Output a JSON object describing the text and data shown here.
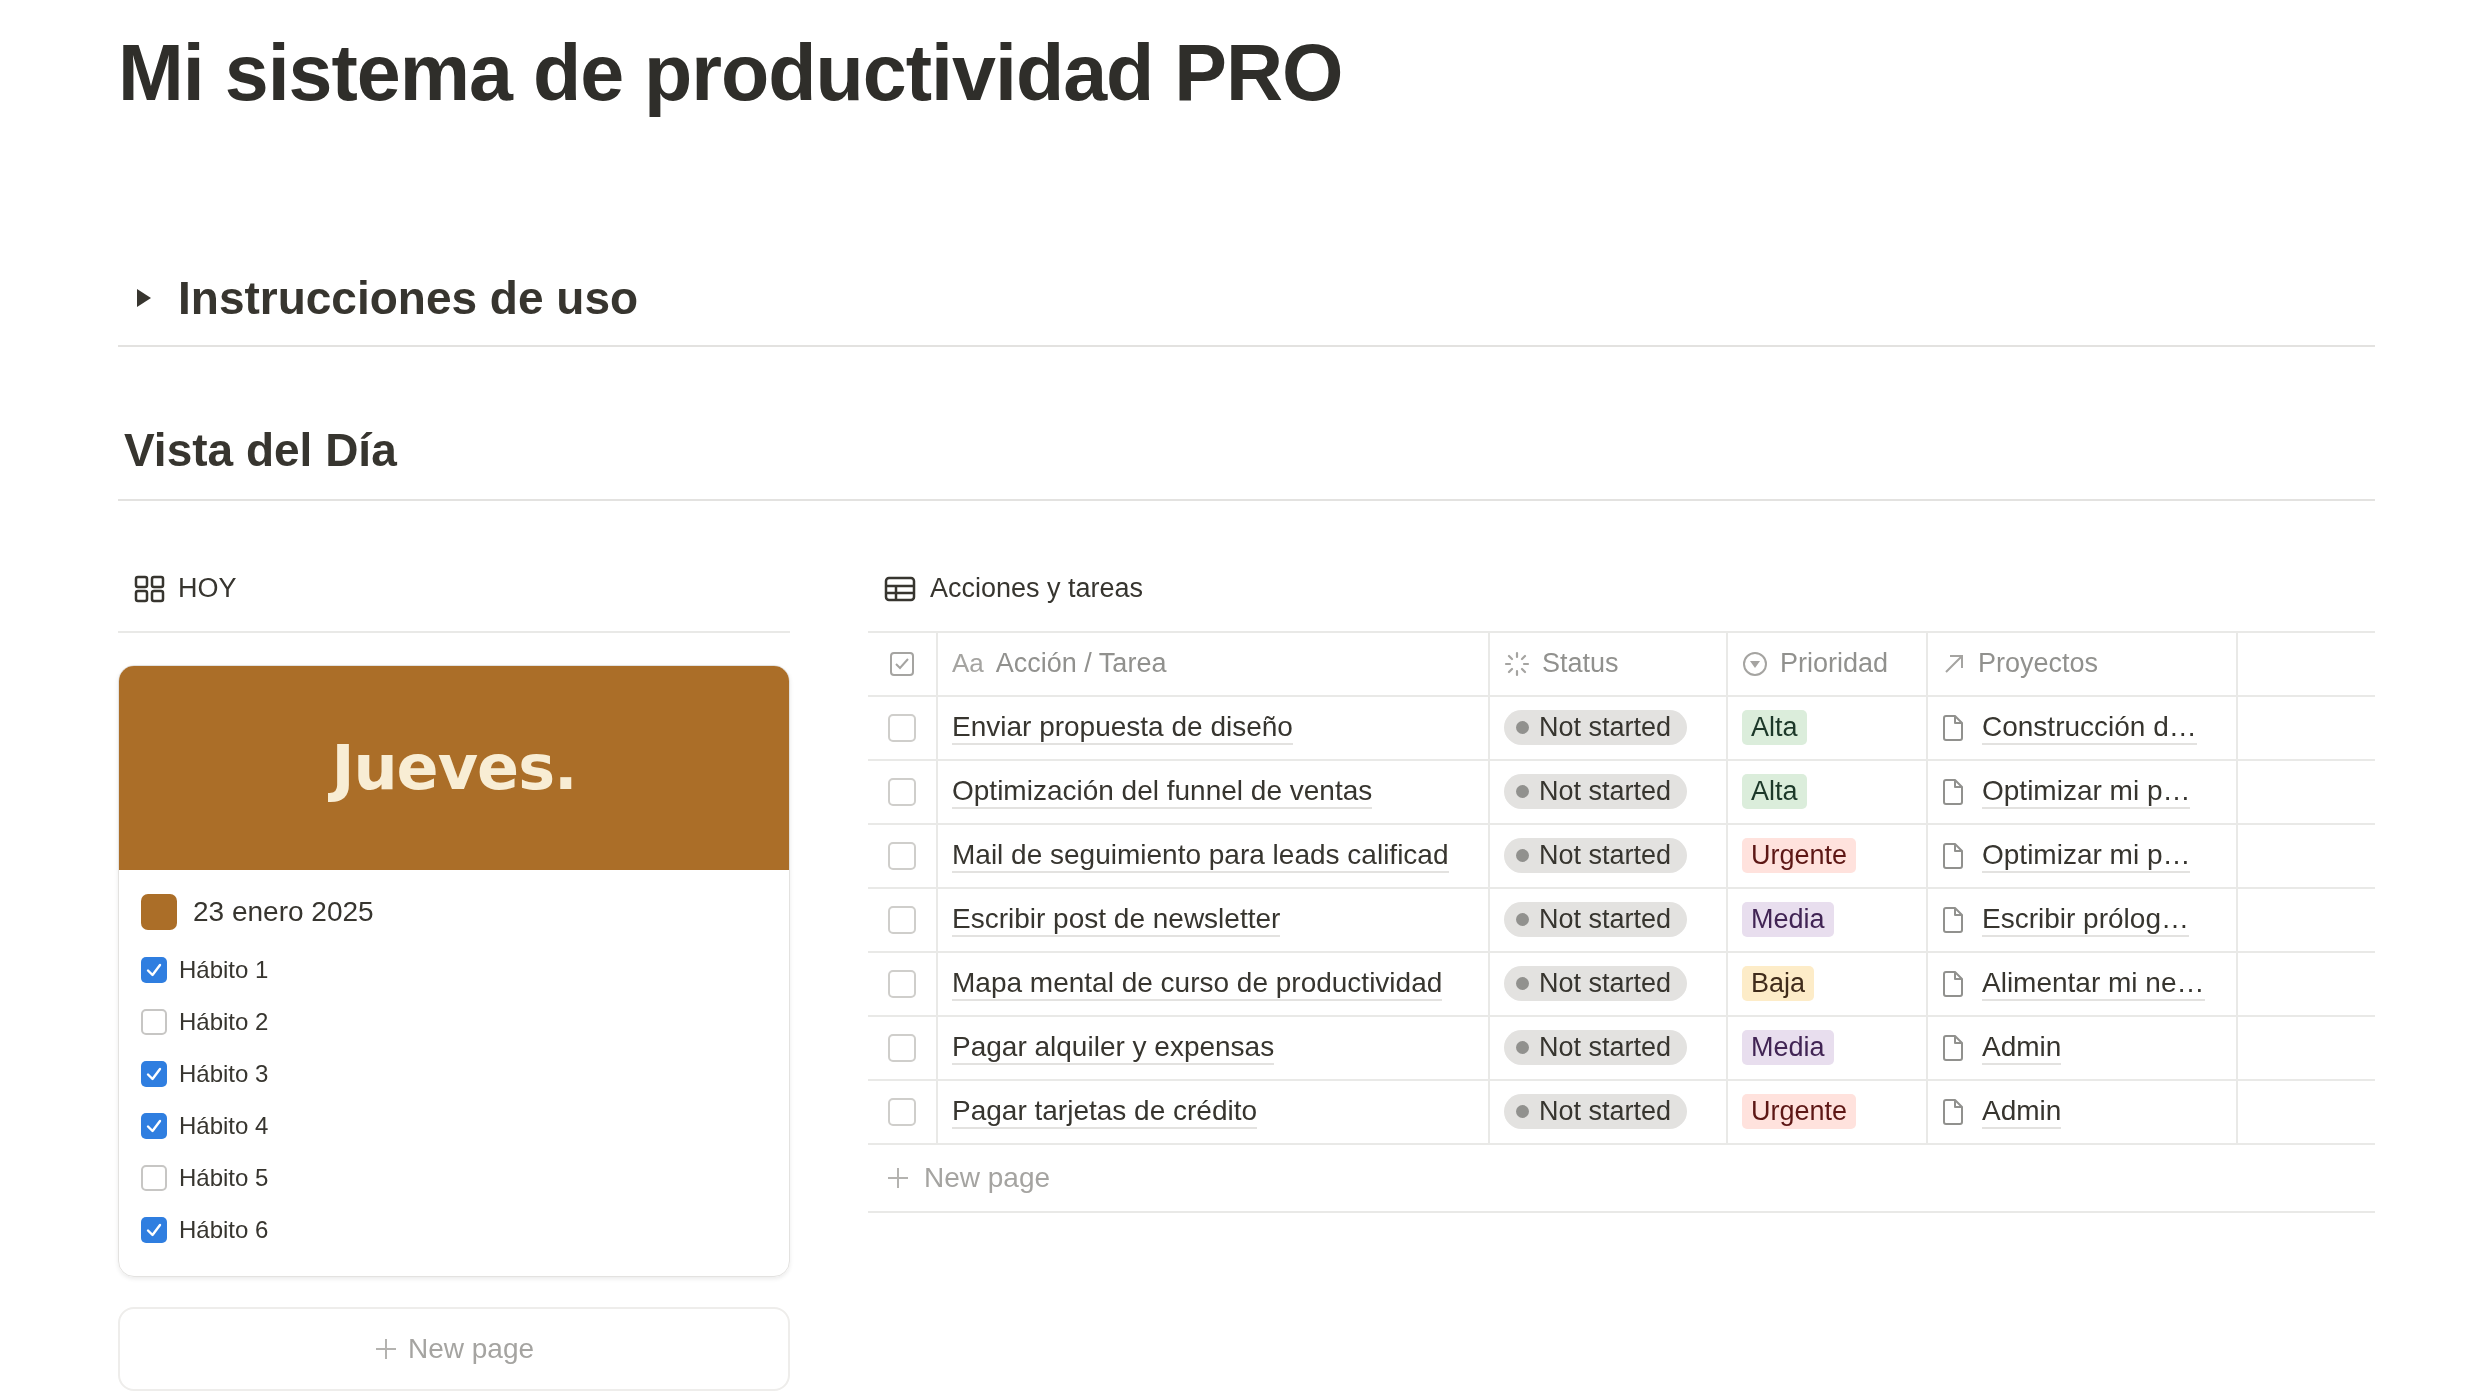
{
  "page": {
    "title": "Mi sistema de productividad PRO"
  },
  "toggle": {
    "label": "Instrucciones de uso",
    "expanded": false
  },
  "section": {
    "heading": "Vista del Día"
  },
  "gallery": {
    "view_label": "HOY",
    "card": {
      "cover_text": "Jueves.",
      "title": "23 enero 2025",
      "habits": [
        {
          "label": "Hábito 1",
          "checked": true
        },
        {
          "label": "Hábito 2",
          "checked": false
        },
        {
          "label": "Hábito 3",
          "checked": true
        },
        {
          "label": "Hábito 4",
          "checked": true
        },
        {
          "label": "Hábito 5",
          "checked": false
        },
        {
          "label": "Hábito 6",
          "checked": true
        }
      ]
    },
    "new_page": "New page"
  },
  "table": {
    "view_label": "Acciones y tareas",
    "columns": [
      {
        "kind": "title",
        "label": "Acción / Tarea",
        "icon_text": "Aa"
      },
      {
        "kind": "status",
        "label": "Status"
      },
      {
        "kind": "select",
        "label": "Prioridad"
      },
      {
        "kind": "relation",
        "label": "Proyectos"
      }
    ],
    "rows": [
      {
        "done": false,
        "name": "Enviar propuesta de diseño",
        "status": "Not started",
        "priority": {
          "label": "Alta",
          "color": "#dbeddb"
        },
        "project": "Construcción d…"
      },
      {
        "done": false,
        "name": "Optimización del funnel de ventas",
        "status": "Not started",
        "priority": {
          "label": "Alta",
          "color": "#dbeddb"
        },
        "project": "Optimizar mi p…"
      },
      {
        "done": false,
        "name": "Mail de seguimiento para leads calificad",
        "status": "Not started",
        "priority": {
          "label": "Urgente",
          "color": "#ffe2dd"
        },
        "project": "Optimizar mi p…"
      },
      {
        "done": false,
        "name": "Escribir post de newsletter",
        "status": "Not started",
        "priority": {
          "label": "Media",
          "color": "#e8deee"
        },
        "project": "Escribir prólog…"
      },
      {
        "done": false,
        "name": "Mapa mental de curso de productividad",
        "status": "Not started",
        "priority": {
          "label": "Baja",
          "color": "#fdecc8"
        },
        "project": "Alimentar mi ne…"
      },
      {
        "done": false,
        "name": "Pagar alquiler y expensas",
        "status": "Not started",
        "priority": {
          "label": "Media",
          "color": "#e8deee"
        },
        "project": "Admin"
      },
      {
        "done": false,
        "name": "Pagar tarjetas de crédito",
        "status": "Not started",
        "priority": {
          "label": "Urgente",
          "color": "#ffe2dd"
        },
        "project": "Admin"
      }
    ],
    "new_page": "New page"
  }
}
